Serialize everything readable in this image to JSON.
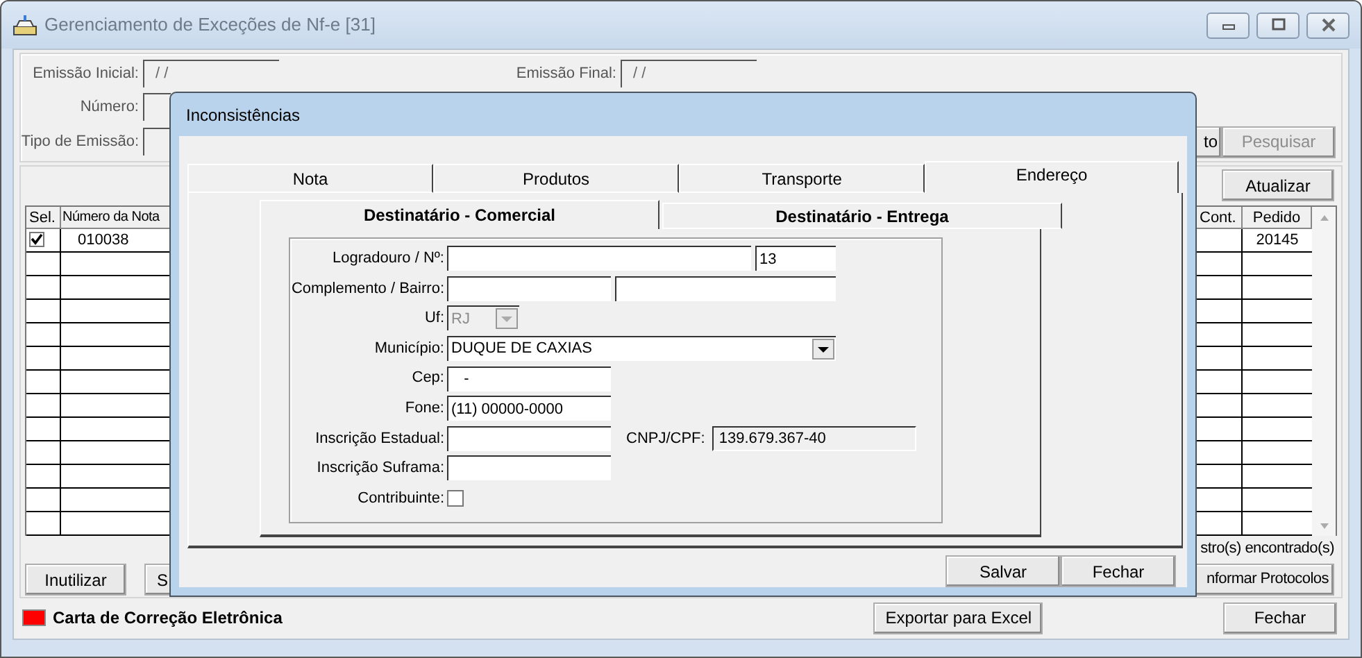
{
  "window": {
    "title": "Gerenciamento de Exceções de Nf-e [31]"
  },
  "filters": [
    {
      "label": "Emissão Inicial:",
      "value": "/ /"
    },
    {
      "label": "Emissão Final:",
      "value": "/ /"
    },
    {
      "label": "Número:"
    },
    {
      "label": "Tipo de Emissão:"
    }
  ],
  "filter_buttons": [
    {
      "label": "to",
      "disabled": false
    },
    {
      "label": "Pesquisar",
      "disabled": true
    }
  ],
  "refresh_button": {
    "label": "Atualizar"
  },
  "table": {
    "columns": [
      "Sel.",
      "Número da Nota",
      "Cont.",
      "Pedido"
    ],
    "rows": [
      {
        "checked": true,
        "number": "010038",
        "pedido": "20145"
      }
    ]
  },
  "record_count": "stro(s) encontrado(s)",
  "action_buttons": [
    {
      "label": "Inutilizar"
    },
    {
      "label": "S"
    },
    {
      "label": "nformar Protocolos"
    }
  ],
  "legend": {
    "label": "Carta de Correção Eletrônica",
    "color": "#ff0000"
  },
  "footer_buttons": [
    {
      "label": "Exportar para Excel"
    },
    {
      "label": "Fechar"
    }
  ],
  "dialog": {
    "title": "Inconsistências",
    "tabs": [
      {
        "label": "Nota",
        "selected": false
      },
      {
        "label": "Produtos",
        "selected": false
      },
      {
        "label": "Transporte",
        "selected": false
      },
      {
        "label": "Endereço",
        "selected": true
      }
    ],
    "subtabs": [
      {
        "label": "Destinatário - Comercial",
        "selected": true
      },
      {
        "label": "Destinatário - Entrega",
        "selected": false
      }
    ],
    "rows": [
      {
        "label": "Logradouro / Nº:",
        "fields": [
          {
            "kind": "text"
          },
          {
            "kind": "text",
            "value": "13"
          }
        ]
      },
      {
        "label": "Complemento / Bairro:",
        "fields": [
          {
            "kind": "text"
          },
          {
            "kind": "text"
          }
        ]
      },
      {
        "label": "Uf:",
        "fields": [
          {
            "kind": "combo",
            "value": "RJ",
            "disabled": true
          }
        ]
      },
      {
        "label": "Município:",
        "fields": [
          {
            "kind": "combo",
            "value": "DUQUE DE CAXIAS",
            "disabled": false
          }
        ]
      },
      {
        "label": "Cep:",
        "fields": [
          {
            "kind": "text",
            "value": "   -"
          }
        ]
      },
      {
        "label": "Fone:",
        "fields": [
          {
            "kind": "text",
            "value": "(11) 00000-0000"
          }
        ]
      },
      {
        "label": "Inscrição Estadual:",
        "fields": [
          {
            "kind": "text"
          },
          {
            "kind": "label",
            "text": "CNPJ/CPF:"
          },
          {
            "kind": "readonly",
            "value": "139.679.367-40"
          }
        ]
      },
      {
        "label": "Inscrição Suframa:",
        "fields": [
          {
            "kind": "text"
          }
        ]
      },
      {
        "label": "Contribuinte:",
        "fields": [
          {
            "kind": "checkbox",
            "checked": false
          }
        ]
      }
    ],
    "buttons": [
      {
        "label": "Salvar"
      },
      {
        "label": "Fechar"
      }
    ]
  }
}
